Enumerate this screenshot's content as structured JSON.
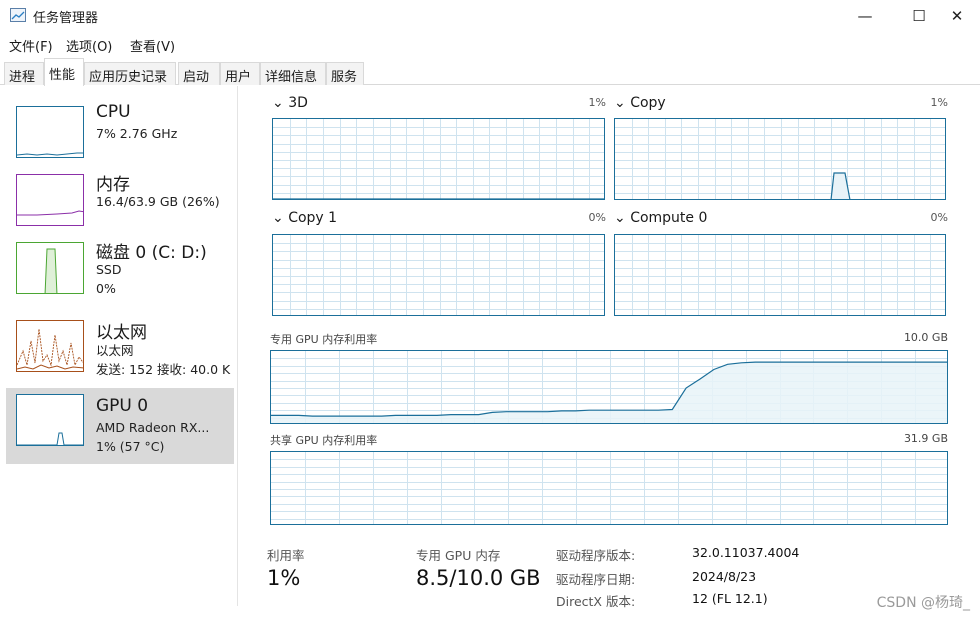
{
  "window": {
    "title": "任务管理器",
    "icon": "task-manager-icon"
  },
  "window_controls": {
    "minimize": "—",
    "maximize": "☐",
    "close": "✕"
  },
  "menu": [
    "文件(F)",
    "选项(O)",
    "查看(V)"
  ],
  "tabs": [
    "进程",
    "性能",
    "应用历史记录",
    "启动",
    "用户",
    "详细信息",
    "服务"
  ],
  "active_tab": "性能",
  "sidebar": [
    {
      "name": "CPU",
      "line1": "7% 2.76 GHz",
      "line2": "",
      "line3": "",
      "color": "#1b6f9a"
    },
    {
      "name": "内存",
      "line1": "16.4/63.9 GB (26%)",
      "line2": "",
      "line3": "",
      "color": "#8b2fa8"
    },
    {
      "name": "磁盘 0 (C: D:)",
      "line1": "SSD",
      "line2": "0%",
      "line3": "",
      "color": "#4ba633"
    },
    {
      "name": "以太网",
      "line1": "以太网",
      "line2": "发送: 152 接收: 40.0 K",
      "line3": "",
      "color": "#a74f1a"
    },
    {
      "name": "GPU 0",
      "line1": "AMD Radeon RX...",
      "line2": "1% (57 °C)",
      "line3": "",
      "color": "#1b6f9a"
    }
  ],
  "engines": [
    {
      "name": "3D",
      "pct": "1%"
    },
    {
      "name": "Copy",
      "pct": "1%"
    },
    {
      "name": "Copy 1",
      "pct": "0%"
    },
    {
      "name": "Compute 0",
      "pct": "0%"
    }
  ],
  "dedicated_memory": {
    "label": "专用 GPU 内存利用率",
    "max": "10.0 GB"
  },
  "shared_memory": {
    "label": "共享 GPU 内存利用率",
    "max": "31.9 GB"
  },
  "stats": {
    "utilization_label": "利用率",
    "utilization_value": "1%",
    "dedicated_label": "专用 GPU 内存",
    "dedicated_value": "8.5/10.0 GB"
  },
  "info": [
    {
      "key": "驱动程序版本:",
      "value": "32.0.11037.4004"
    },
    {
      "key": "驱动程序日期:",
      "value": "2024/8/23"
    },
    {
      "key": "DirectX 版本:",
      "value": "12 (FL 12.1)"
    }
  ],
  "watermark": "CSDN @杨琦_",
  "colors": {
    "accent": "#1b6f9a",
    "grid": "#cfe3ef",
    "fill": "#e8f3f8"
  },
  "chart_data": {
    "dedicated_memory_percent": [
      13,
      13,
      13,
      12,
      12,
      12,
      12,
      12,
      12,
      13,
      13,
      13,
      13,
      14,
      14,
      14,
      17,
      18,
      18,
      18,
      18,
      19,
      19,
      20,
      20,
      20,
      20,
      20,
      20,
      21,
      50,
      62,
      75,
      82,
      84,
      85,
      85,
      85,
      85,
      85,
      85,
      85,
      85,
      85,
      85,
      85,
      85,
      85,
      85,
      85
    ],
    "copy_engine_percent": [
      0,
      0,
      0,
      0,
      0,
      0,
      0,
      0,
      0,
      0,
      0,
      0,
      0,
      0,
      0,
      0,
      0,
      0,
      0,
      0,
      0,
      0,
      0,
      0,
      0,
      0,
      0,
      0,
      0,
      0,
      0,
      0,
      0,
      0,
      0,
      0,
      0,
      0,
      0,
      0,
      0,
      0,
      0,
      0,
      0,
      0,
      0,
      0,
      0,
      0,
      0,
      0,
      0,
      0,
      0,
      0,
      0,
      0,
      0,
      0,
      0,
      0,
      0,
      0,
      0,
      0,
      0,
      0,
      0,
      0,
      0,
      0,
      0,
      0,
      0,
      0,
      0,
      0,
      0,
      0,
      0,
      0,
      0,
      0,
      0,
      0,
      0,
      0,
      0,
      0,
      0,
      0,
      0,
      0,
      0,
      0,
      0,
      0,
      0,
      0
    ]
  }
}
